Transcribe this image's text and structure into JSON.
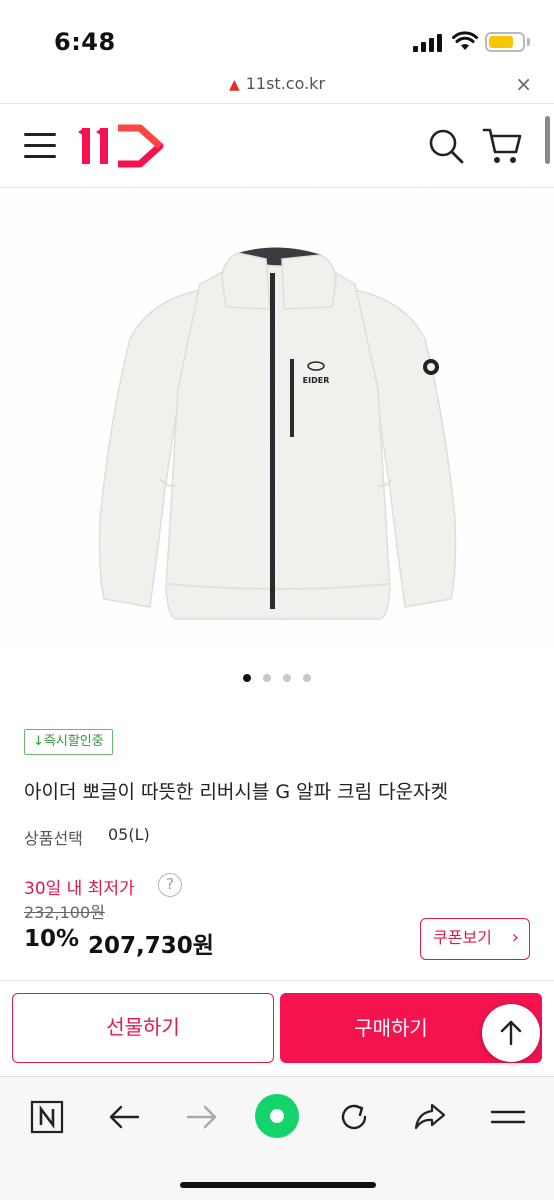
{
  "status_bar": {
    "time": "6:48"
  },
  "browser": {
    "url": "11st.co.kr",
    "close": "×"
  },
  "header": {
    "logo_alt": "11"
  },
  "gallery": {
    "total": 4,
    "active": 0
  },
  "product": {
    "badge": "↓즉시할인중",
    "name": "아이더 뽀글이 따뜻한 리버시블 G 알파 크림 다운자켓",
    "option_label": "상품선택",
    "option_value": "05(L)",
    "lowest_label": "30일 내 최저가",
    "help": "?",
    "original_price": "232,100원",
    "discount": "10%",
    "price": "207,730원",
    "coupon_label": "쿠폰보기",
    "coupon_chevron": "›"
  },
  "actions": {
    "gift": "선물하기",
    "buy": "구매하기"
  },
  "colors": {
    "brand": "#f5134f",
    "accent_text": "#e0194e",
    "badge": "#2f9a3a",
    "browser_active": "#13d36b"
  },
  "icons": [
    "warning-icon",
    "hamburger-icon",
    "search-icon",
    "cart-icon",
    "help-icon",
    "chevron-right-icon",
    "arrow-up-icon",
    "naver-icon",
    "back-icon",
    "forward-icon",
    "home-dot-icon",
    "refresh-icon",
    "share-icon",
    "menu-icon"
  ]
}
